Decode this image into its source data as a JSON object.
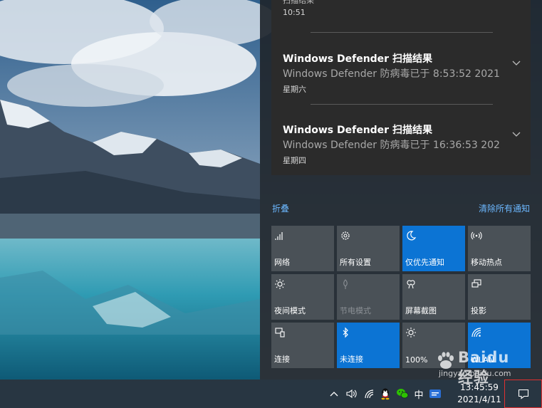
{
  "notifications": {
    "previous_partial": "扫描结果",
    "previous_time": "10:51",
    "items": [
      {
        "title": "Windows Defender 扫描结果",
        "body": "Windows Defender 防病毒已于 8:53:52 2021",
        "day": "星期六"
      },
      {
        "title": "Windows Defender 扫描结果",
        "body": "Windows Defender 防病毒已于 16:36:53 202",
        "day": "星期四"
      }
    ]
  },
  "action_center": {
    "collapse_label": "折叠",
    "clear_all_label": "清除所有通知",
    "tiles": [
      {
        "label": "网络",
        "icon": "network-icon",
        "state": "off"
      },
      {
        "label": "所有设置",
        "icon": "gear-icon",
        "state": "off"
      },
      {
        "label": "仅优先通知",
        "icon": "moon-icon",
        "state": "on"
      },
      {
        "label": "移动热点",
        "icon": "hotspot-icon",
        "state": "off"
      },
      {
        "label": "夜间模式",
        "icon": "brightness-icon",
        "state": "off"
      },
      {
        "label": "节电模式",
        "icon": "battery-saver-icon",
        "state": "disabled"
      },
      {
        "label": "屏幕截图",
        "icon": "snip-icon",
        "state": "off"
      },
      {
        "label": "投影",
        "icon": "project-icon",
        "state": "off"
      },
      {
        "label": "连接",
        "icon": "connect-icon",
        "state": "off"
      },
      {
        "label": "未连接",
        "icon": "bluetooth-icon",
        "state": "on"
      },
      {
        "label": "100%",
        "icon": "brightness-icon",
        "state": "off"
      },
      {
        "label": "WLAN",
        "icon": "wifi-icon",
        "state": "on"
      }
    ]
  },
  "taskbar": {
    "ime_label": "中",
    "time": "13:45:59",
    "date": "2021/4/11"
  },
  "watermark": {
    "brand": "Baidu 经验",
    "url": "jingyan.baidu.com"
  },
  "colors": {
    "accent": "#0c74d4",
    "tile_off": "#4a5157",
    "link": "#6cb8ff"
  }
}
